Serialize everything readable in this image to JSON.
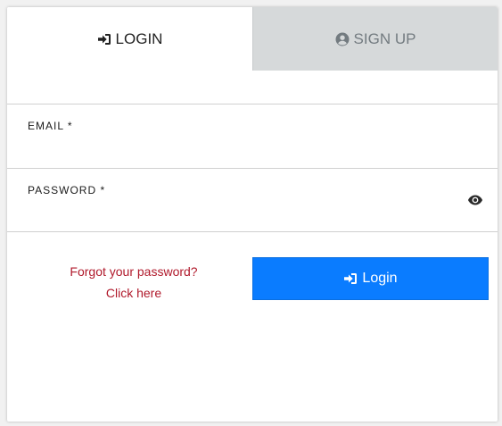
{
  "tabs": {
    "login_label": "LOGIN",
    "signup_label": "SIGN UP"
  },
  "form": {
    "email_label": "EMAIL *",
    "email_value": "",
    "password_label": "PASSWORD *",
    "password_value": ""
  },
  "forgot": {
    "line1": "Forgot your password?",
    "line2": "Click here"
  },
  "login_button_label": "Login",
  "icons": {
    "login_tab": "sign-in-icon",
    "signup_tab": "user-circle-icon",
    "password_toggle": "eye-icon",
    "login_button": "sign-in-icon"
  },
  "colors": {
    "accent": "#0a7cff",
    "inactive_tab": "#d6d9da",
    "link": "#b0192b"
  }
}
